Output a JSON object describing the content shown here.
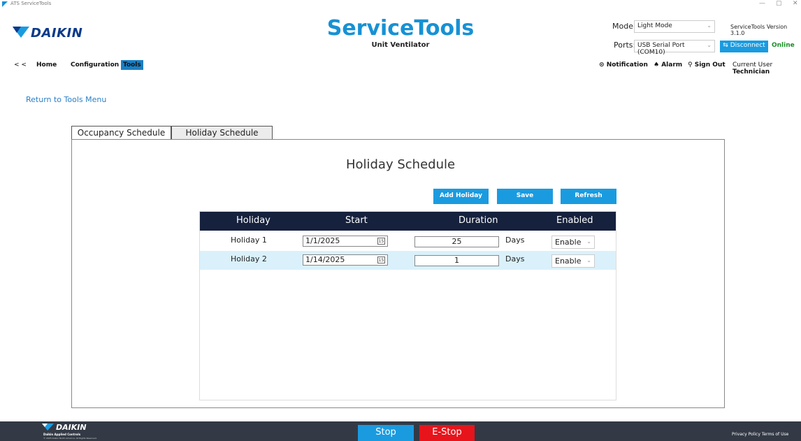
{
  "window": {
    "title": "ATS ServiceTools",
    "controls": [
      "—",
      "▢",
      "✕"
    ]
  },
  "brand": {
    "logo_text": "DAIKIN",
    "colors": {
      "primary": "#1a9be0",
      "navy": "#15213d",
      "danger": "#e8141b",
      "online": "#1d8f2a"
    }
  },
  "header": {
    "title": "ServiceTools",
    "subtitle": "Unit Ventilator",
    "mode_label": "Mode:",
    "mode_value": "Light Mode",
    "ports_label": "Ports:",
    "ports_value": "USB Serial Port (COM10)",
    "version": "ServiceTools Version 3.1.0",
    "disconnect_label": "Disconnect",
    "status": "Online"
  },
  "nav": {
    "back": "< <",
    "home": "Home",
    "configuration": "Configuration",
    "tools": "Tools"
  },
  "right_nav": {
    "notification": "Notification",
    "alarm": "Alarm",
    "sign_out": "Sign Out",
    "current_user_label": "Current User",
    "current_user": "Technician"
  },
  "return_link": "Return to Tools Menu",
  "tabs": [
    {
      "label": "Occupancy Schedule"
    },
    {
      "label": "Holiday Schedule"
    }
  ],
  "panel": {
    "title": "Holiday Schedule",
    "buttons": {
      "add": "Add Holiday",
      "save": "Save",
      "refresh": "Refresh"
    },
    "columns": [
      "Holiday",
      "Start",
      "Duration",
      "Enabled"
    ],
    "rows": [
      {
        "name": "Holiday 1",
        "start": "1/1/2025",
        "duration": "25",
        "unit": "Days",
        "enabled": "Enable"
      },
      {
        "name": "Holiday 2",
        "start": "1/14/2025",
        "duration": "1",
        "unit": "Days",
        "enabled": "Enable"
      }
    ]
  },
  "footer": {
    "logo_text": "DAIKIN",
    "company": "Daikin Applied Controls",
    "copyright": "© 2025 Daikin North America. All Rights Reserved.",
    "stop": "Stop",
    "estop": "E-Stop",
    "privacy": "Privacy Policy",
    "terms": "Terms of Use"
  }
}
